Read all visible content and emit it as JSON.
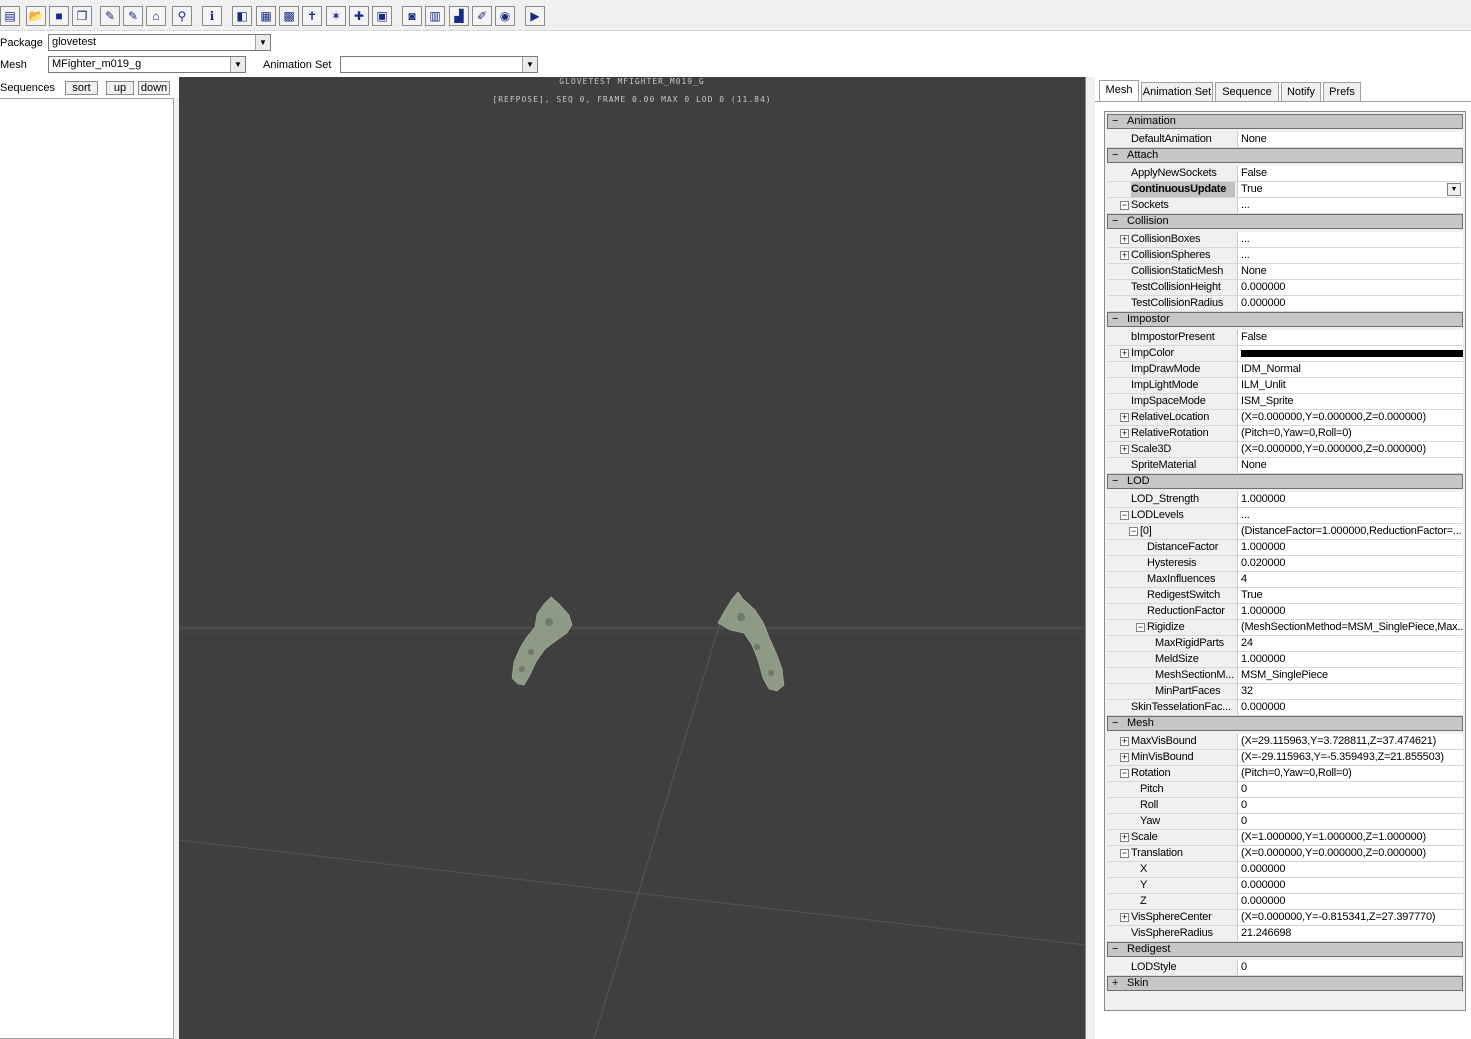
{
  "toolbar": {
    "buttons": [
      {
        "name": "import-icon",
        "glyph": "▤"
      },
      {
        "name": "open-folder-icon",
        "glyph": "📂"
      },
      {
        "name": "save-icon",
        "glyph": "■"
      },
      {
        "name": "copy-icon",
        "glyph": "❐"
      },
      {
        "name": "edit-props-icon",
        "glyph": "✎"
      },
      {
        "name": "edit-anim-icon",
        "glyph": "✎"
      },
      {
        "name": "edit-mesh-icon",
        "glyph": "⌂"
      },
      {
        "name": "link-icon",
        "glyph": "⚲"
      },
      {
        "name": "info-icon",
        "glyph": "ℹ"
      },
      {
        "name": "cube-icon",
        "glyph": "◧"
      },
      {
        "name": "wireframe-icon",
        "glyph": "▦"
      },
      {
        "name": "grid-icon",
        "glyph": "▩"
      },
      {
        "name": "skeleton-icon",
        "glyph": "✝"
      },
      {
        "name": "bone-names-icon",
        "glyph": "✶"
      },
      {
        "name": "socket-icon",
        "glyph": "✚"
      },
      {
        "name": "bounds-icon",
        "glyph": "▣"
      },
      {
        "name": "camera-icon",
        "glyph": "◙"
      },
      {
        "name": "film-icon",
        "glyph": "▥"
      },
      {
        "name": "lod-icon",
        "glyph": "▟"
      },
      {
        "name": "lod-edit-icon",
        "glyph": "✐"
      },
      {
        "name": "record-icon",
        "glyph": "◉"
      },
      {
        "name": "play-icon",
        "glyph": "▶"
      }
    ]
  },
  "package": {
    "label": "Package",
    "value": "glovetest"
  },
  "mesh": {
    "label": "Mesh",
    "value": "MFighter_m019_g"
  },
  "animset": {
    "label": "Animation Set",
    "value": ""
  },
  "sequences": {
    "label": "Sequences",
    "sort": "sort",
    "up": "up",
    "down": "down"
  },
  "viewport": {
    "line1": "GLOVETEST MFIGHTER_M019_G",
    "line2": "[REFPOSE], SEQ 0,  FRAME  0.00 MAX 0  LOD 0 (11.84)",
    "bg": "#3f3f3f",
    "mesh_color": "#8e9a84"
  },
  "tabs": [
    "Mesh",
    "Animation Set",
    "Sequence",
    "Notify",
    "Prefs"
  ],
  "props": [
    {
      "t": "c",
      "name": "Animation",
      "sign": "−"
    },
    {
      "t": "p",
      "name": "DefaultAnimation",
      "value": "None",
      "ind": 0
    },
    {
      "t": "c",
      "name": "Attach",
      "sign": "−"
    },
    {
      "t": "p",
      "name": "ApplyNewSockets",
      "value": "False",
      "ind": 0
    },
    {
      "t": "p",
      "name": "ContinuousUpdate",
      "value": "True",
      "ind": 0,
      "sel": true
    },
    {
      "t": "p",
      "name": "Sockets",
      "value": "...",
      "ind": 0,
      "exp": "−"
    },
    {
      "t": "c",
      "name": "Collision",
      "sign": "−"
    },
    {
      "t": "p",
      "name": "CollisionBoxes",
      "value": "...",
      "ind": 0,
      "exp": "+"
    },
    {
      "t": "p",
      "name": "CollisionSpheres",
      "value": "...",
      "ind": 0,
      "exp": "+"
    },
    {
      "t": "p",
      "name": "CollisionStaticMesh",
      "value": "None",
      "ind": 0
    },
    {
      "t": "p",
      "name": "TestCollisionHeight",
      "value": "0.000000",
      "ind": 0
    },
    {
      "t": "p",
      "name": "TestCollisionRadius",
      "value": "0.000000",
      "ind": 0
    },
    {
      "t": "c",
      "name": "Impostor",
      "sign": "−"
    },
    {
      "t": "p",
      "name": "bImpostorPresent",
      "value": "False",
      "ind": 0
    },
    {
      "t": "p",
      "name": "ImpColor",
      "value": "",
      "ind": 0,
      "exp": "+",
      "swatch": "#000000"
    },
    {
      "t": "p",
      "name": "ImpDrawMode",
      "value": "IDM_Normal",
      "ind": 0
    },
    {
      "t": "p",
      "name": "ImpLightMode",
      "value": "ILM_Unlit",
      "ind": 0
    },
    {
      "t": "p",
      "name": "ImpSpaceMode",
      "value": "ISM_Sprite",
      "ind": 0
    },
    {
      "t": "p",
      "name": "RelativeLocation",
      "value": "(X=0.000000,Y=0.000000,Z=0.000000)",
      "ind": 0,
      "exp": "+"
    },
    {
      "t": "p",
      "name": "RelativeRotation",
      "value": "(Pitch=0,Yaw=0,Roll=0)",
      "ind": 0,
      "exp": "+"
    },
    {
      "t": "p",
      "name": "Scale3D",
      "value": "(X=0.000000,Y=0.000000,Z=0.000000)",
      "ind": 0,
      "exp": "+"
    },
    {
      "t": "p",
      "name": "SpriteMaterial",
      "value": "None",
      "ind": 0
    },
    {
      "t": "c",
      "name": "LOD",
      "sign": "−"
    },
    {
      "t": "p",
      "name": "LOD_Strength",
      "value": "1.000000",
      "ind": 0
    },
    {
      "t": "p",
      "name": "LODLevels",
      "value": "...",
      "ind": 0,
      "exp": "−"
    },
    {
      "t": "p",
      "name": "[0]",
      "value": "(DistanceFactor=1.000000,ReductionFactor=...",
      "ind": 1,
      "exp": "−"
    },
    {
      "t": "p",
      "name": "DistanceFactor",
      "value": "1.000000",
      "ind": 2
    },
    {
      "t": "p",
      "name": "Hysteresis",
      "value": "0.020000",
      "ind": 2
    },
    {
      "t": "p",
      "name": "MaxInfluences",
      "value": "4",
      "ind": 2
    },
    {
      "t": "p",
      "name": "RedigestSwitch",
      "value": "True",
      "ind": 2
    },
    {
      "t": "p",
      "name": "ReductionFactor",
      "value": "1.000000",
      "ind": 2
    },
    {
      "t": "p",
      "name": "Rigidize",
      "value": "(MeshSectionMethod=MSM_SinglePiece,Max...",
      "ind": 2,
      "exp": "−"
    },
    {
      "t": "p",
      "name": "MaxRigidParts",
      "value": "24",
      "ind": 3
    },
    {
      "t": "p",
      "name": "MeldSize",
      "value": "1.000000",
      "ind": 3
    },
    {
      "t": "p",
      "name": "MeshSectionM...",
      "value": "MSM_SinglePiece",
      "ind": 3
    },
    {
      "t": "p",
      "name": "MinPartFaces",
      "value": "32",
      "ind": 3
    },
    {
      "t": "p",
      "name": "SkinTesselationFac...",
      "value": "0.000000",
      "ind": 0
    },
    {
      "t": "c",
      "name": "Mesh",
      "sign": "−"
    },
    {
      "t": "p",
      "name": "MaxVisBound",
      "value": "(X=29.115963,Y=3.728811,Z=37.474621)",
      "ind": 0,
      "exp": "+"
    },
    {
      "t": "p",
      "name": "MinVisBound",
      "value": "(X=-29.115963,Y=-5.359493,Z=21.855503)",
      "ind": 0,
      "exp": "+"
    },
    {
      "t": "p",
      "name": "Rotation",
      "value": "(Pitch=0,Yaw=0,Roll=0)",
      "ind": 0,
      "exp": "−"
    },
    {
      "t": "p",
      "name": "Pitch",
      "value": "0",
      "ind": 1
    },
    {
      "t": "p",
      "name": "Roll",
      "value": "0",
      "ind": 1
    },
    {
      "t": "p",
      "name": "Yaw",
      "value": "0",
      "ind": 1
    },
    {
      "t": "p",
      "name": "Scale",
      "value": "(X=1.000000,Y=1.000000,Z=1.000000)",
      "ind": 0,
      "exp": "+"
    },
    {
      "t": "p",
      "name": "Translation",
      "value": "(X=0.000000,Y=0.000000,Z=0.000000)",
      "ind": 0,
      "exp": "−"
    },
    {
      "t": "p",
      "name": "X",
      "value": "0.000000",
      "ind": 1
    },
    {
      "t": "p",
      "name": "Y",
      "value": "0.000000",
      "ind": 1
    },
    {
      "t": "p",
      "name": "Z",
      "value": "0.000000",
      "ind": 1
    },
    {
      "t": "p",
      "name": "VisSphereCenter",
      "value": "(X=0.000000,Y=-0.815341,Z=27.397770)",
      "ind": 0,
      "exp": "+"
    },
    {
      "t": "p",
      "name": "VisSphereRadius",
      "value": "21.246698",
      "ind": 0
    },
    {
      "t": "c",
      "name": "Redigest",
      "sign": "−"
    },
    {
      "t": "p",
      "name": "LODStyle",
      "value": "0",
      "ind": 0
    },
    {
      "t": "c",
      "name": "Skin",
      "sign": "+"
    }
  ]
}
